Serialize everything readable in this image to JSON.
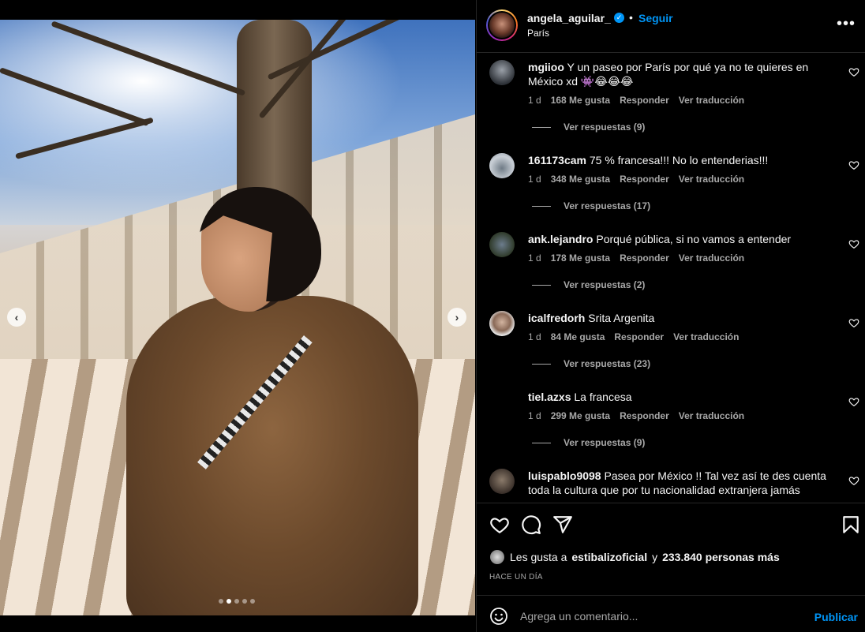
{
  "post": {
    "username": "angela_aguilar_",
    "follow_label": "Seguir",
    "dot_separator": "•",
    "location": "París",
    "more_label": "•••"
  },
  "media": {
    "carousel_count": 5,
    "active_index": 1,
    "prev_arrow": "‹",
    "next_arrow": "›"
  },
  "comments": [
    {
      "username": "mgiioo",
      "text": "Y un paseo por París por qué ya no te quieres en México xd 👾😂😂😂",
      "time": "1 d",
      "likes": "168 Me gusta",
      "reply": "Responder",
      "translate": "Ver traducción",
      "view_replies": "Ver respuestas (9)"
    },
    {
      "username": "161173cam",
      "text": "75 % francesa!!! No lo entenderias!!!",
      "time": "1 d",
      "likes": "348 Me gusta",
      "reply": "Responder",
      "translate": "Ver traducción",
      "view_replies": "Ver respuestas (17)"
    },
    {
      "username": "ank.lejandro",
      "text": "Porqué pública, si no vamos a entender",
      "time": "1 d",
      "likes": "178 Me gusta",
      "reply": "Responder",
      "translate": "Ver traducción",
      "view_replies": "Ver respuestas (2)"
    },
    {
      "username": "icalfredorh",
      "text": "Srita Argenita",
      "time": "1 d",
      "likes": "84 Me gusta",
      "reply": "Responder",
      "translate": "Ver traducción",
      "view_replies": "Ver respuestas (23)"
    },
    {
      "username": "tiel.azxs",
      "text": "La francesa",
      "time": "1 d",
      "likes": "299 Me gusta",
      "reply": "Responder",
      "translate": "Ver traducción",
      "view_replies": "Ver respuestas (9)"
    },
    {
      "username": "luispablo9098",
      "text": "Pasea por México !! Tal vez así te des cuenta toda la cultura que por tu nacionalidad extranjera jamás",
      "time": "",
      "likes": "",
      "reply": "",
      "translate": "",
      "view_replies": ""
    }
  ],
  "likes_summary": {
    "prefix": "Les gusta a",
    "liker": "estibalizoficial",
    "conjunction": "y",
    "others": "233.840 personas más"
  },
  "time_ago": "HACE UN DÍA",
  "add_comment": {
    "placeholder": "Agrega un comentario...",
    "publish_label": "Publicar"
  },
  "colors": {
    "accent": "#0095f6",
    "background": "#000000",
    "secondary_text": "#a8a8a8",
    "divider": "#262626"
  }
}
